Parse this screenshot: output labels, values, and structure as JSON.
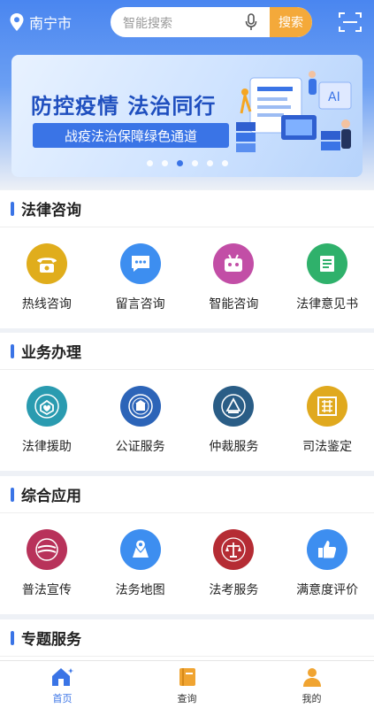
{
  "header": {
    "city": "南宁市",
    "search_placeholder": "智能搜索",
    "search_button": "搜索"
  },
  "banner": {
    "title": "防控疫情  法治同行",
    "subtitle": "战疫法治保障绿色通道",
    "slide_count": 6,
    "active_slide": 3
  },
  "sections": [
    {
      "title": "法律咨询",
      "items": [
        {
          "label": "热线咨询",
          "icon": "telephone-icon",
          "color": "#e0ad1c"
        },
        {
          "label": "留言咨询",
          "icon": "chat-bubble-icon",
          "color": "#3d8ef0"
        },
        {
          "label": "智能咨询",
          "icon": "robot-icon",
          "color": "#c24ea6"
        },
        {
          "label": "法律意见书",
          "icon": "document-icon",
          "color": "#2fb16b"
        }
      ]
    },
    {
      "title": "业务办理",
      "items": [
        {
          "label": "法律援助",
          "icon": "legal-aid-emblem-icon",
          "color": "#2a9bb0"
        },
        {
          "label": "公证服务",
          "icon": "notary-emblem-icon",
          "color": "#2c64b8"
        },
        {
          "label": "仲裁服务",
          "icon": "arbitration-emblem-icon",
          "color": "#2a5d86"
        },
        {
          "label": "司法鉴定",
          "icon": "forensic-seal-icon",
          "color": "#e0a91e"
        }
      ]
    },
    {
      "title": "综合应用",
      "items": [
        {
          "label": "普法宣传",
          "icon": "law-publicity-icon",
          "color": "#b8325a"
        },
        {
          "label": "法务地图",
          "icon": "map-pin-icon",
          "color": "#3d8ef0"
        },
        {
          "label": "法考服务",
          "icon": "justice-scales-icon",
          "color": "#b52c34"
        },
        {
          "label": "满意度评价",
          "icon": "thumbs-up-icon",
          "color": "#3d8ef0"
        }
      ]
    },
    {
      "title": "专题服务",
      "items": []
    }
  ],
  "nav": [
    {
      "label": "首页",
      "icon": "home-icon",
      "active": true
    },
    {
      "label": "查询",
      "icon": "book-icon",
      "active": false
    },
    {
      "label": "我的",
      "icon": "user-icon",
      "active": false
    }
  ]
}
